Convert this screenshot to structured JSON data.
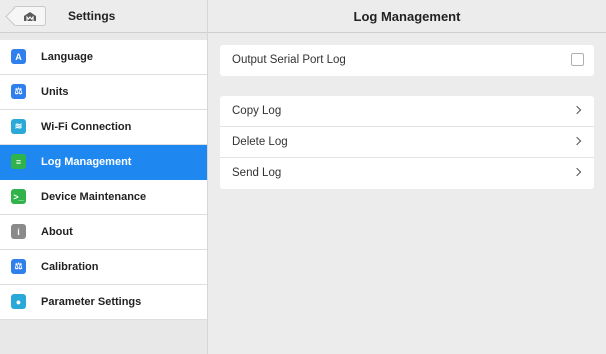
{
  "left_panel": {
    "title": "Settings",
    "items": [
      {
        "label": "Language",
        "icon": "language-icon",
        "color": "#2f80ed",
        "glyph": "A",
        "active": false
      },
      {
        "label": "Units",
        "icon": "scale-icon",
        "color": "#2f80ed",
        "glyph": "⚖",
        "active": false
      },
      {
        "label": "Wi-Fi Connection",
        "icon": "wifi-icon",
        "color": "#2aa9d8",
        "glyph": "≋",
        "active": false
      },
      {
        "label": "Log Management",
        "icon": "log-icon",
        "color": "#2fb34a",
        "glyph": "≡",
        "active": true
      },
      {
        "label": "Device Maintenance",
        "icon": "terminal-icon",
        "color": "#2fb34a",
        "glyph": ">_",
        "active": false
      },
      {
        "label": "About",
        "icon": "info-icon",
        "color": "#8a8a8a",
        "glyph": "i",
        "active": false
      },
      {
        "label": "Calibration",
        "icon": "calibration-icon",
        "color": "#2f80ed",
        "glyph": "⚖",
        "active": false
      },
      {
        "label": "Parameter Settings",
        "icon": "drop-icon",
        "color": "#2aa9d8",
        "glyph": "●",
        "active": false
      }
    ]
  },
  "right_panel": {
    "title": "Log Management",
    "serial_card": {
      "label": "Output Serial Port Log",
      "checked": false
    },
    "actions": [
      {
        "label": "Copy Log"
      },
      {
        "label": "Delete Log"
      },
      {
        "label": "Send Log"
      }
    ]
  },
  "colors": {
    "accent": "#1e88f0",
    "background": "#ececec"
  }
}
